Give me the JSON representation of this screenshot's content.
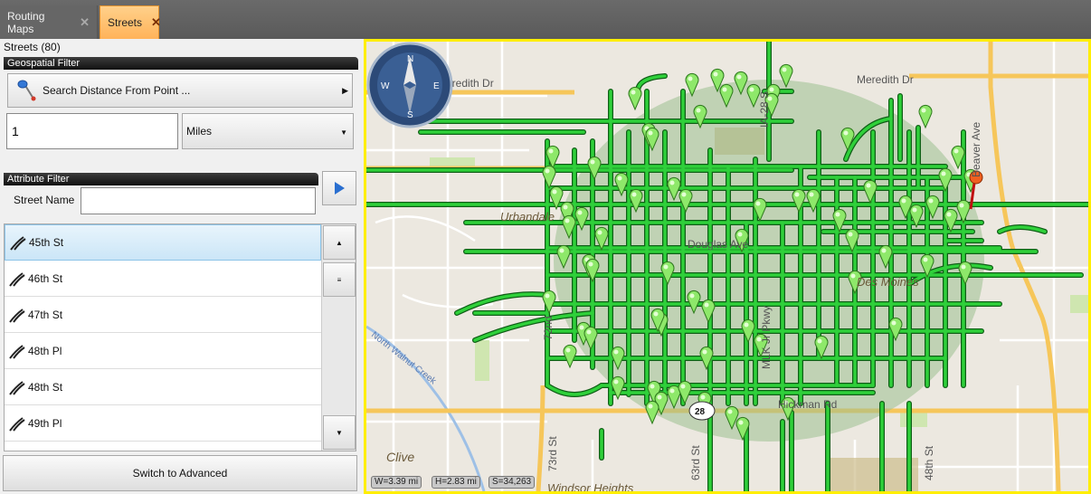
{
  "tabs": [
    {
      "label": "Routing Maps",
      "active": false
    },
    {
      "label": "Streets",
      "active": true
    }
  ],
  "streets_count": "Streets (80)",
  "geospatial_filter": {
    "header": "Geospatial Filter",
    "search_button": "Search Distance From Point ...",
    "distance_value": "1",
    "units_selected": "Miles"
  },
  "attribute_filter": {
    "header": "Attribute Filter",
    "street_name_label": "Street Name",
    "street_name_value": ""
  },
  "street_list": [
    "45th St",
    "46th St",
    "47th St",
    "48th Pl",
    "48th St",
    "49th Pl"
  ],
  "selected_street": "45th St",
  "switch_button": "Switch to Advanced",
  "map": {
    "labels": {
      "meredith_left": "Meredith Dr",
      "meredith_right": "Meredith Dr",
      "urbandale": "Urbandale",
      "douglas": "Douglas Ave",
      "des_moines": "Des Moines",
      "clive": "Clive",
      "windsor": "Windsor Heights",
      "hickman": "Hickman Rd",
      "beaver": "Beaver Ave",
      "rd72": "72nd",
      "rd73": "73rd St",
      "rd63": "63rd St",
      "rd48": "48th St",
      "mlk": "MLK Jr Pkwy",
      "ia28": "IA-28 S",
      "creek": "North Walnut Creek",
      "shield": "28"
    },
    "width": "W=3.39 mi",
    "height": "H=2.83 mi",
    "scale": "S=34,263",
    "colors": {
      "street": "#2fd03a",
      "buffer": "#9cbf8f",
      "highway": "#f6c65a",
      "border": "#ffee00"
    }
  }
}
